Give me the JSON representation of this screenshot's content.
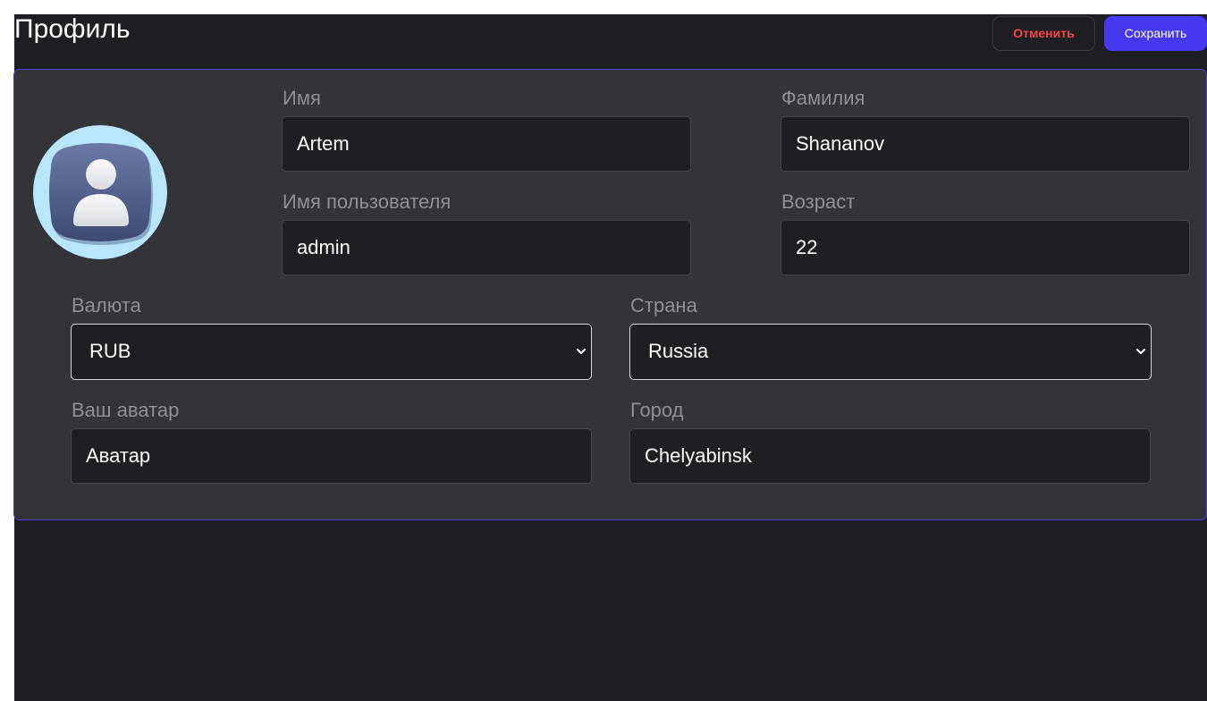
{
  "header": {
    "title": "Профиль",
    "cancel_label": "Отменить",
    "save_label": "Сохранить"
  },
  "profile": {
    "first_name": {
      "label": "Имя",
      "value": "Artem"
    },
    "last_name": {
      "label": "Фамилия",
      "value": "Shananov"
    },
    "username": {
      "label": "Имя пользователя",
      "value": "admin"
    },
    "age": {
      "label": "Возраст",
      "value": "22"
    },
    "currency": {
      "label": "Валюта",
      "value": "RUB"
    },
    "country": {
      "label": "Страна",
      "value": "Russia"
    },
    "avatar": {
      "label": "Ваш аватар",
      "value": "Аватар"
    },
    "city": {
      "label": "Город",
      "value": "Chelyabinsk"
    }
  },
  "icons": {
    "avatar": "user-avatar-icon",
    "select_caret": "chevron-down-icon"
  },
  "colors": {
    "background": "#1f1e23",
    "card": "#333338",
    "card_border": "#4b3ed8",
    "primary": "#4539f0",
    "danger": "#f04545",
    "avatar_bg": "#b8e6fd"
  }
}
